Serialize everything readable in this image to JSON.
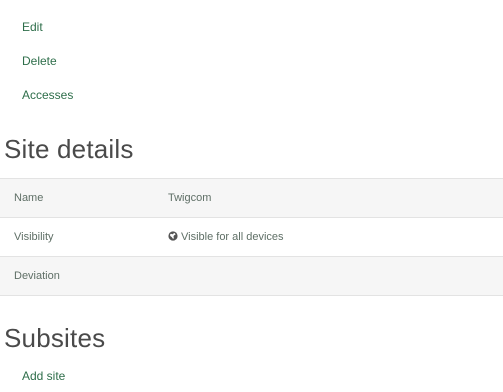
{
  "actions": {
    "edit": "Edit",
    "delete": "Delete",
    "accesses": "Accesses"
  },
  "site_details": {
    "title": "Site details",
    "rows": [
      {
        "label": "Name",
        "value": "Twigcom"
      },
      {
        "label": "Visibility",
        "value": "Visible for all devices",
        "icon": "globe-icon"
      },
      {
        "label": "Deviation",
        "value": ""
      }
    ]
  },
  "subsites": {
    "title": "Subsites",
    "add_label": "Add site"
  },
  "colors": {
    "link": "#2e6e4a",
    "row_stripe": "#f6f6f6"
  }
}
